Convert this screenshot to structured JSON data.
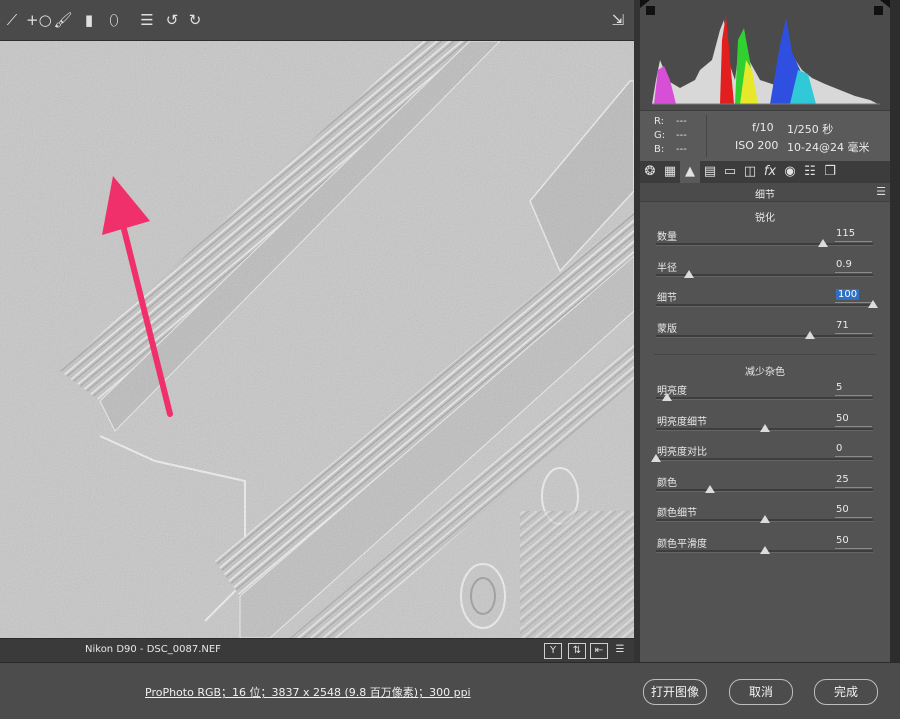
{
  "toolbar": {
    "tools": [
      "white-balance-tool-icon",
      "spot-removal-tool-icon",
      "adjustment-brush-icon",
      "graduated-filter-icon",
      "radial-filter-icon",
      "presets-list-icon",
      "rotate-ccw-icon",
      "rotate-cw-icon"
    ],
    "open_preview_icon": "open-in-photoshop-icon"
  },
  "status": {
    "file_label": "Nikon D90 -  DSC_0087.NEF",
    "icons": [
      "Y",
      "⇅",
      "⇤",
      "☰"
    ]
  },
  "info": {
    "r_label": "R:",
    "r_value": "---",
    "g_label": "G:",
    "g_value": "---",
    "b_label": "B:",
    "b_value": "---",
    "aperture": "f/10",
    "shutter": "1/250 秒",
    "iso": "ISO 200",
    "lens": "10-24@24 毫米"
  },
  "panel": {
    "section_title": "细节",
    "sharpen_title": "锐化",
    "noise_title": "减少杂色",
    "sharpen": [
      {
        "label": "数量",
        "value": "115",
        "fraction": 0.77
      },
      {
        "label": "半径",
        "value": "0.9",
        "fraction": 0.15
      },
      {
        "label": "细节",
        "value": "100",
        "fraction": 1.0,
        "selected": true
      },
      {
        "label": "蒙版",
        "value": "71",
        "fraction": 0.71
      }
    ],
    "noise": [
      {
        "label": "明亮度",
        "value": "5",
        "fraction": 0.05
      },
      {
        "label": "明亮度细节",
        "value": "50",
        "fraction": 0.5
      },
      {
        "label": "明亮度对比",
        "value": "0",
        "fraction": 0.0
      },
      {
        "label": "颜色",
        "value": "25",
        "fraction": 0.25
      },
      {
        "label": "颜色细节",
        "value": "50",
        "fraction": 0.5
      },
      {
        "label": "颜色平滑度",
        "value": "50",
        "fraction": 0.5
      }
    ]
  },
  "footer": {
    "workflow_link": "ProPhoto RGB；16 位；3837 x 2548 (9.8 百万像素)；300 ppi",
    "open_image": "打开图像",
    "cancel": "取消",
    "done": "完成"
  },
  "colors": {
    "arrow": "#f0306a",
    "selection": "#2f6fc4"
  }
}
